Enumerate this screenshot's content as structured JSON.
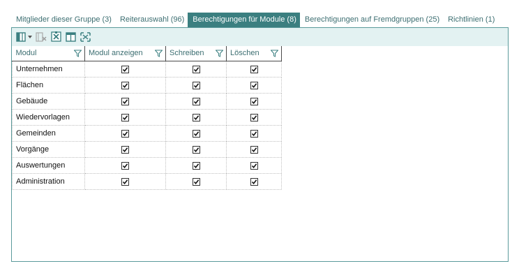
{
  "tabs": [
    {
      "label": "Mitglieder dieser Gruppe (3)",
      "active": false
    },
    {
      "label": "Reiterauswahl (96)",
      "active": false
    },
    {
      "label": "Berechtigungen für Module (8)",
      "active": true
    },
    {
      "label": "Berechtigungen auf Fremdgruppen (25)",
      "active": false
    },
    {
      "label": "Richtlinien (1)",
      "active": false
    }
  ],
  "toolbar": {
    "buttons": [
      {
        "icon": "column-chooser-icon"
      },
      {
        "icon": "clear-filter-icon"
      },
      {
        "icon": "export-excel-icon"
      },
      {
        "icon": "layout-icon"
      },
      {
        "icon": "fit-columns-icon"
      }
    ]
  },
  "grid": {
    "columns": [
      {
        "label": "Modul"
      },
      {
        "label": "Modul anzeigen"
      },
      {
        "label": "Schreiben"
      },
      {
        "label": "Löschen"
      }
    ],
    "rows": [
      {
        "name": "Unternehmen",
        "anzeigen": true,
        "schreiben": true,
        "loeschen": true
      },
      {
        "name": "Flächen",
        "anzeigen": true,
        "schreiben": true,
        "loeschen": true
      },
      {
        "name": "Gebäude",
        "anzeigen": true,
        "schreiben": true,
        "loeschen": true
      },
      {
        "name": "Wiedervorlagen",
        "anzeigen": true,
        "schreiben": true,
        "loeschen": true
      },
      {
        "name": "Gemeinden",
        "anzeigen": true,
        "schreiben": true,
        "loeschen": true
      },
      {
        "name": "Vorgänge",
        "anzeigen": true,
        "schreiben": true,
        "loeschen": true
      },
      {
        "name": "Auswertungen",
        "anzeigen": true,
        "schreiben": true,
        "loeschen": true
      },
      {
        "name": "Administration",
        "anzeigen": true,
        "schreiben": true,
        "loeschen": true
      }
    ]
  },
  "colors": {
    "accent": "#3b7f80",
    "tab_text": "#3c6e71",
    "toolbar_bg": "#e3f2f2",
    "panel_border": "#5b9a9b"
  }
}
